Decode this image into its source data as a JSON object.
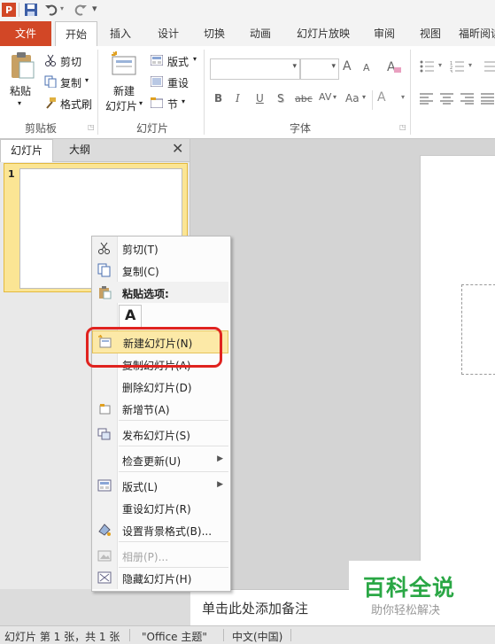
{
  "ribbon_tabs": [
    "文件",
    "开始",
    "插入",
    "设计",
    "切换",
    "动画",
    "幻灯片放映",
    "审阅",
    "视图",
    "福昕阅读"
  ],
  "clipboard": {
    "paste": "粘贴",
    "cut": "剪切",
    "copy": "复制",
    "format_painter": "格式刷",
    "label": "剪贴板"
  },
  "slides_group": {
    "new_slide_l1": "新建",
    "new_slide_l2": "幻灯片",
    "layout": "版式",
    "reset": "重设",
    "section": "节",
    "label": "幻灯片"
  },
  "font_group": {
    "label": "字体",
    "bold": "B",
    "italic": "I",
    "underline": "U",
    "shadow": "S",
    "strike": "abc",
    "spacing": "AV",
    "case": "Aa",
    "grow": "A",
    "shrink": "A"
  },
  "pane_tabs": [
    "幻灯片",
    "大纲"
  ],
  "slide_number": "1",
  "context_menu": {
    "items": [
      {
        "label": "剪切(T)",
        "icon": "scissors-icon",
        "enabled": true
      },
      {
        "label": "复制(C)",
        "icon": "copy-icon",
        "enabled": true
      },
      {
        "label": "粘贴选项:",
        "icon": "paste-icon",
        "enabled": true
      },
      {
        "label": "A",
        "icon": "paste-text-icon",
        "enabled": true
      },
      {
        "label": "新建幻灯片(N)",
        "icon": "new-slide-icon",
        "enabled": true
      },
      {
        "label": "复制幻灯片(A)",
        "icon": "",
        "enabled": true
      },
      {
        "label": "删除幻灯片(D)",
        "icon": "",
        "enabled": true
      },
      {
        "label": "新增节(A)",
        "icon": "new-section-icon",
        "enabled": true
      },
      {
        "label": "发布幻灯片(S)",
        "icon": "publish-icon",
        "enabled": true
      },
      {
        "label": "检查更新(U)",
        "icon": "",
        "enabled": true
      },
      {
        "label": "版式(L)",
        "icon": "layout-icon",
        "enabled": true
      },
      {
        "label": "重设幻灯片(R)",
        "icon": "",
        "enabled": true
      },
      {
        "label": "设置背景格式(B)...",
        "icon": "background-icon",
        "enabled": true
      },
      {
        "label": "相册(P)...",
        "icon": "album-icon",
        "enabled": false
      },
      {
        "label": "隐藏幻灯片(H)",
        "icon": "hide-slide-icon",
        "enabled": true
      }
    ]
  },
  "notes_placeholder": "单击此处添加备注",
  "watermark": {
    "title": "百科全说",
    "subtitle": "助你轻松解决"
  },
  "status_bar": {
    "slide_info": "幻灯片 第 1 张，共 1 张",
    "theme": "\"Office 主题\"",
    "language": "中文(中国)"
  },
  "colors": {
    "file_tab": "#d24726",
    "highlight": "#fce9a7",
    "annotation": "#e0231f",
    "watermark": "#2aa745"
  }
}
